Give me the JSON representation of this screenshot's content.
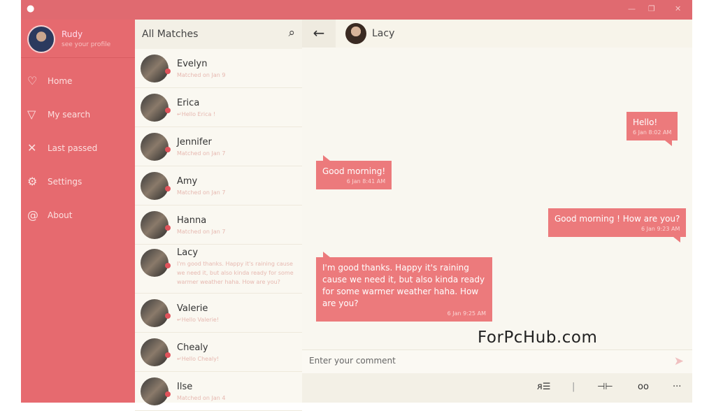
{
  "window": {
    "min": "—",
    "max": "❐",
    "close": "✕",
    "logo_icon": "flame-icon"
  },
  "profile": {
    "name": "Rudy",
    "subtitle": "see your profile"
  },
  "nav": [
    {
      "label": "Home",
      "icon": "♡"
    },
    {
      "label": "My search",
      "icon": "▽"
    },
    {
      "label": "Last passed",
      "icon": "✕"
    },
    {
      "label": "Settings",
      "icon": "⚙"
    },
    {
      "label": "About",
      "icon": "@"
    }
  ],
  "list": {
    "title": "All Matches",
    "search_icon": "⌕",
    "items": [
      {
        "name": "Evelyn",
        "sub": "Matched on Jan 9"
      },
      {
        "name": "Erica",
        "sub": "↵Hello Erica !"
      },
      {
        "name": "Jennifer",
        "sub": "Matched on Jan 7"
      },
      {
        "name": "Amy",
        "sub": "Matched on Jan 7"
      },
      {
        "name": "Hanna",
        "sub": "Matched on Jan 7"
      },
      {
        "name": "Lacy",
        "sub": "I'm good thanks. Happy it's raining cause we need it, but also kinda ready for some warmer weather haha. How are you?"
      },
      {
        "name": "Valerie",
        "sub": "↵Hello Valerie!"
      },
      {
        "name": "Chealy",
        "sub": "↵Hello Chealy!"
      },
      {
        "name": "Ilse",
        "sub": "Matched on Jan 4"
      }
    ]
  },
  "chat": {
    "back": "←",
    "name": "Lacy",
    "messages": [
      {
        "text": "Hello!",
        "time": "6 Jan 8:02 AM",
        "side": "right"
      },
      {
        "text": "Good morning!",
        "time": "6 Jan 8:41 AM",
        "side": "left"
      },
      {
        "text": "Good morning ! How are you?",
        "time": "6 Jan 9:23 AM",
        "side": "right"
      },
      {
        "text": "I'm good thanks. Happy it's raining cause we need it, but also kinda ready for some warmer weather haha. How are you?",
        "time": "6 Jan 9:25 AM",
        "side": "left"
      }
    ],
    "input_placeholder": "Enter your comment",
    "send": "➤",
    "tools": {
      "contact": "ᴙ☰",
      "divider": "|",
      "pin": "⊣⊢",
      "voicemail": "oo",
      "more": "···"
    }
  },
  "watermark": "ForPcHub.com"
}
